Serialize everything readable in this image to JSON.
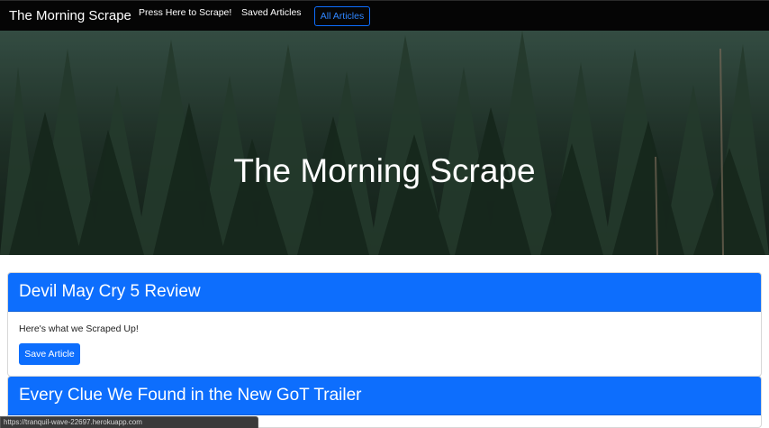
{
  "navbar": {
    "brand": "The Morning Scrape",
    "links": [
      {
        "label": "Press Here to Scrape!"
      },
      {
        "label": "Saved Articles"
      },
      {
        "label": "All Articles"
      }
    ]
  },
  "hero": {
    "title": "The Morning Scrape"
  },
  "articles": [
    {
      "title": "Devil May Cry 5 Review",
      "text": "Here's what we Scraped Up!",
      "button_label": "Save Article"
    },
    {
      "title": "Every Clue We Found in the New GoT Trailer"
    }
  ],
  "status_bar": {
    "url": "https://tranquil-wave-22697.herokuapp.com"
  },
  "colors": {
    "navbar_bg": "#050505",
    "primary": "#0d6efd",
    "hero_overlay": "#1e3128"
  }
}
